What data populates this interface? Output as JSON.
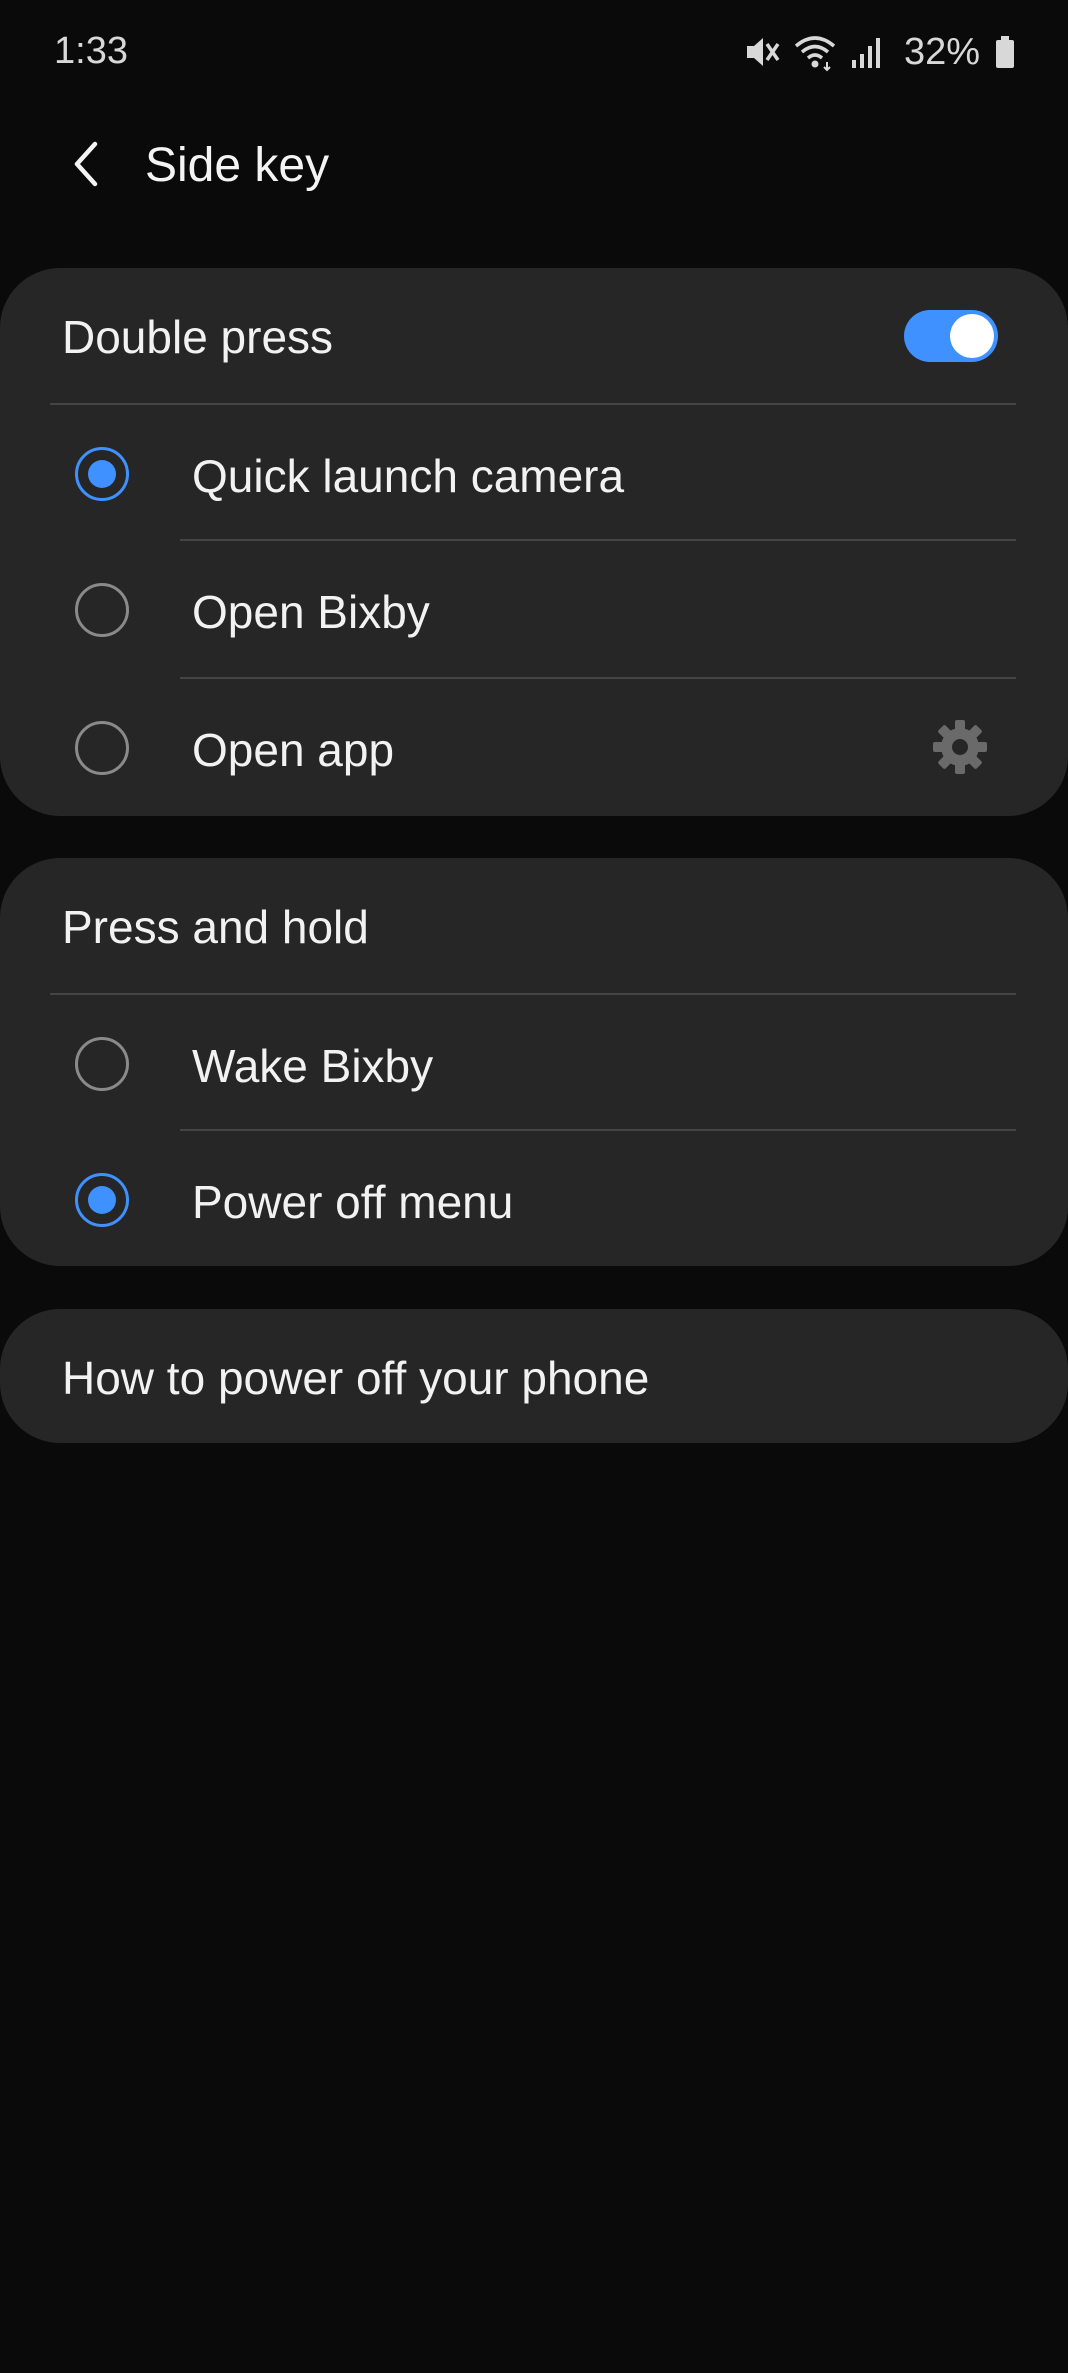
{
  "status_bar": {
    "time": "1:33",
    "battery": "32%",
    "icons": [
      "mute-icon",
      "wifi-icon",
      "signal-icon",
      "battery-icon"
    ]
  },
  "header": {
    "back_icon": "back-arrow-icon",
    "title": "Side key"
  },
  "double_press": {
    "title": "Double press",
    "toggle_on": true,
    "options": [
      {
        "label": "Quick launch camera",
        "selected": true
      },
      {
        "label": "Open Bixby",
        "selected": false
      },
      {
        "label": "Open app",
        "selected": false,
        "settings_icon": "gear-icon"
      }
    ]
  },
  "press_and_hold": {
    "title": "Press and hold",
    "options": [
      {
        "label": "Wake Bixby",
        "selected": false
      },
      {
        "label": "Power off menu",
        "selected": true
      }
    ]
  },
  "help_link": {
    "label": "How to power off your phone"
  },
  "colors": {
    "accent": "#3e91ff",
    "background": "#0a0a0a",
    "card": "#262626"
  }
}
